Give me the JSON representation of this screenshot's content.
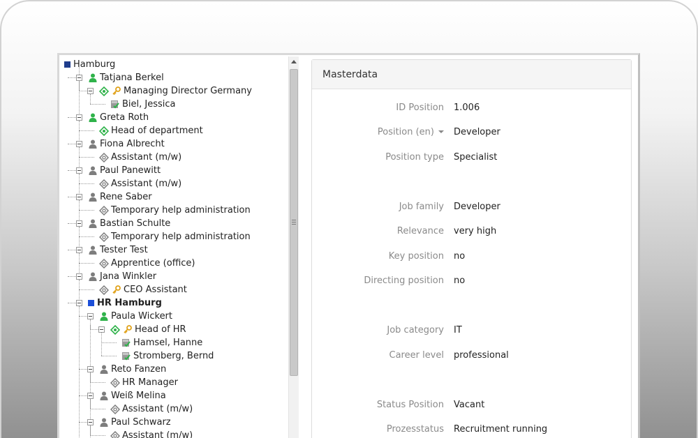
{
  "tree": {
    "root": "Hamburg",
    "nodes": [
      {
        "type": "person-active",
        "label": "Tatjana Berkel"
      },
      {
        "type": "position-key",
        "label": "Managing Director Germany"
      },
      {
        "type": "employee",
        "label": "Biel, Jessica"
      },
      {
        "type": "person-active",
        "label": "Greta Roth"
      },
      {
        "type": "position-active",
        "label": "Head of department"
      },
      {
        "type": "person",
        "label": "Fiona Albrecht"
      },
      {
        "type": "position",
        "label": "Assistant (m/w)"
      },
      {
        "type": "person",
        "label": "Paul Panewitt"
      },
      {
        "type": "position",
        "label": "Assistant (m/w)"
      },
      {
        "type": "person",
        "label": "Rene Saber"
      },
      {
        "type": "position",
        "label": "Temporary help administration"
      },
      {
        "type": "person",
        "label": "Bastian Schulte"
      },
      {
        "type": "position",
        "label": "Temporary help administration"
      },
      {
        "type": "person",
        "label": "Tester Test"
      },
      {
        "type": "position",
        "label": "Apprentice (office)"
      },
      {
        "type": "person",
        "label": "Jana Winkler"
      },
      {
        "type": "position-key-grey",
        "label": "CEO Assistant"
      },
      {
        "type": "unit",
        "label": "HR Hamburg"
      },
      {
        "type": "person-active",
        "label": "Paula Wickert"
      },
      {
        "type": "position-key",
        "label": "Head of HR"
      },
      {
        "type": "employee",
        "label": "Hamsel, Hanne"
      },
      {
        "type": "employee",
        "label": "Stromberg, Bernd"
      },
      {
        "type": "person",
        "label": "Reto Fanzen"
      },
      {
        "type": "position",
        "label": "HR Manager"
      },
      {
        "type": "person",
        "label": "Weiß Melina"
      },
      {
        "type": "position",
        "label": "Assistant (m/w)"
      },
      {
        "type": "person",
        "label": "Paul Schwarz"
      },
      {
        "type": "position",
        "label": "Assistant (m/w)"
      }
    ]
  },
  "masterdata": {
    "title": "Masterdata",
    "fields": [
      {
        "label": "ID Position",
        "value": "1.006"
      },
      {
        "label": "Position (en)",
        "value": "Developer",
        "dropdown": true
      },
      {
        "label": "Position type",
        "value": "Specialist"
      },
      {
        "label": "Job family",
        "value": "Developer"
      },
      {
        "label": "Relevance",
        "value": "very high"
      },
      {
        "label": "Key position",
        "value": "no"
      },
      {
        "label": "Directing position",
        "value": "no"
      },
      {
        "label": "Job category",
        "value": "IT"
      },
      {
        "label": "Career level",
        "value": "professional"
      },
      {
        "label": "Status Position",
        "value": "Vacant"
      },
      {
        "label": "Prozesstatus",
        "value": "Recruitment running"
      }
    ]
  },
  "colors": {
    "unit_square_root": "#1f3d8c",
    "unit_square": "#1d4fd8",
    "active_green": "#2fb24a",
    "inactive_grey": "#7d7d7d",
    "key_gold": "#e0a21a"
  }
}
